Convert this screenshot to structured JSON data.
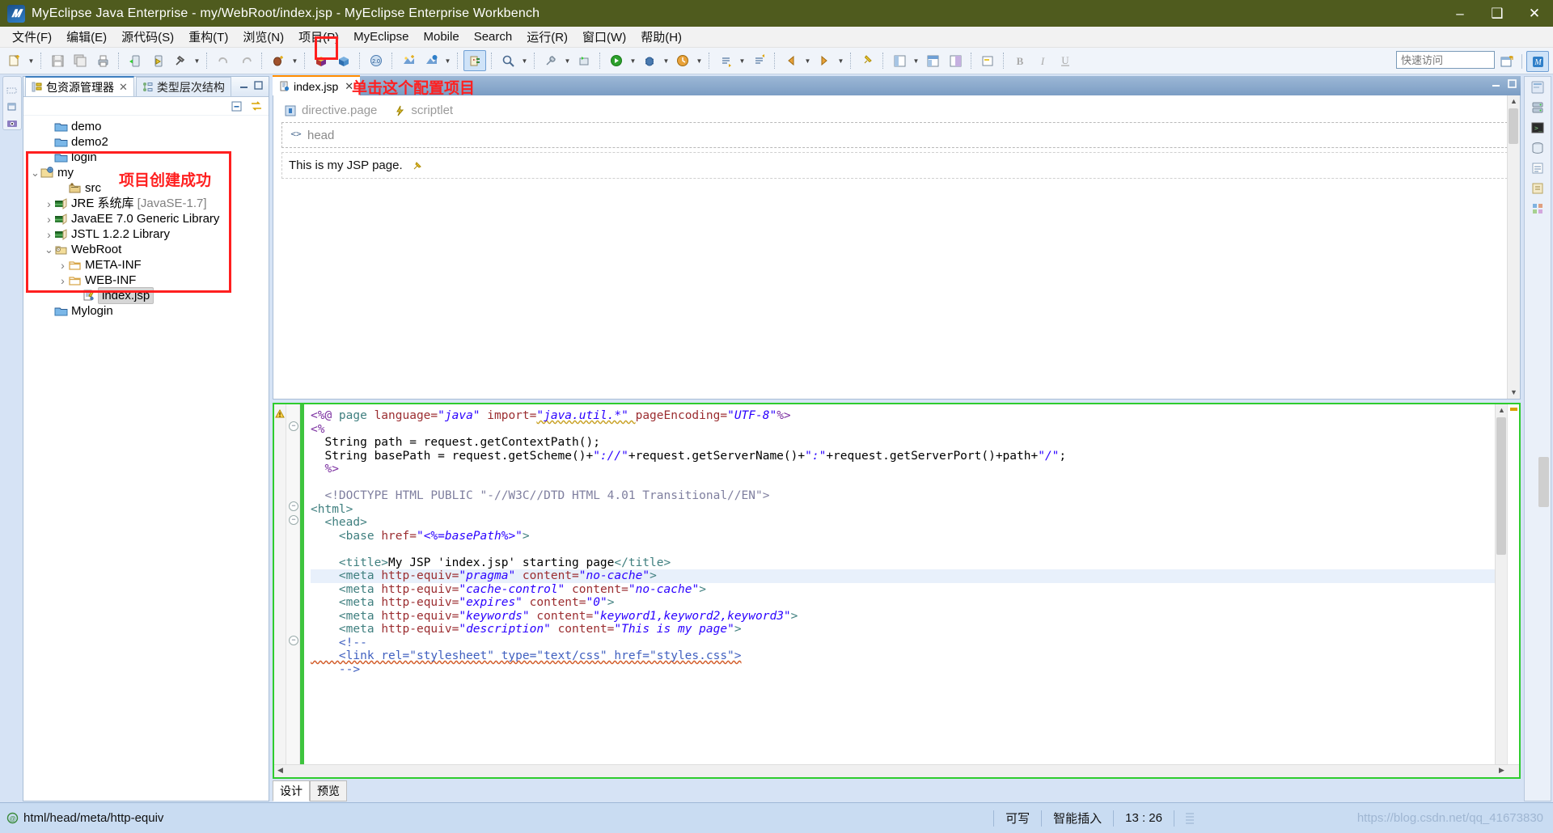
{
  "window": {
    "title": "MyEclipse Java Enterprise  -  my/WebRoot/index.jsp  -  MyEclipse Enterprise Workbench",
    "app_icon": "myeclipse-icon",
    "minimize": "–",
    "maximize": "❑",
    "close": "✕"
  },
  "menubar": {
    "items": [
      {
        "label": "文件(F)"
      },
      {
        "label": "编辑(E)"
      },
      {
        "label": "源代码(S)"
      },
      {
        "label": "重构(T)"
      },
      {
        "label": "浏览(N)"
      },
      {
        "label": "项目(P)"
      },
      {
        "label": "MyEclipse"
      },
      {
        "label": "Mobile"
      },
      {
        "label": "Search"
      },
      {
        "label": "运行(R)"
      },
      {
        "label": "窗口(W)"
      },
      {
        "label": "帮助(H)"
      }
    ]
  },
  "toolbar": {
    "quick_access_placeholder": "快速访问",
    "highlighted_button": "configure-project-button",
    "buttons": [
      "new-wizard-icon",
      "save-icon",
      "save-all-icon",
      "print-icon",
      "run-server-icon",
      "deploy-myeclipse-icon",
      "build-hammer-icon",
      "undo-arrow-icon",
      "redo-arrow-icon",
      "debug-bean-icon",
      "new-package-icon",
      "new-class-icon",
      "web-20-icon",
      "new-jsp-icon",
      "open-browser-icon",
      "configure-project-icon",
      "search-icon",
      "wrench-icon",
      "external-tools-icon",
      "run-icon",
      "debug-icon",
      "profile-icon",
      "next-annotation-icon",
      "previous-annotation-icon",
      "back-icon",
      "forward-icon",
      "pin-editor-icon",
      "perspective-java-icon",
      "perspective-web-icon",
      "perspective-db-icon",
      "toggle-mark-occurrences-icon",
      "bold-icon",
      "italic-icon",
      "underline-icon"
    ],
    "right_buttons": [
      "open-perspective-icon",
      "myeclipse-perspective-icon"
    ]
  },
  "annotations": {
    "toolbar_note": "单击这个配置项目",
    "tree_note": "项目创建成功"
  },
  "explorer": {
    "tabs": [
      {
        "label": "包资源管理器",
        "icon": "package-explorer-icon",
        "active": true,
        "closable": true
      },
      {
        "label": "类型层次结构",
        "icon": "type-hierarchy-icon",
        "active": false,
        "closable": false
      }
    ],
    "view_buttons": [
      "collapse-all-icon",
      "link-with-editor-icon",
      "view-menu-icon"
    ],
    "panel_buttons": [
      "minimize-icon",
      "maximize-icon"
    ],
    "tree": [
      {
        "label": "demo",
        "icon": "project-closed-icon",
        "indent": 1,
        "twisty": "",
        "selected": false
      },
      {
        "label": "demo2",
        "icon": "project-closed-icon",
        "indent": 1,
        "twisty": "",
        "selected": false
      },
      {
        "label": "login",
        "icon": "project-closed-icon",
        "indent": 1,
        "twisty": "",
        "selected": false
      },
      {
        "label": "my",
        "icon": "web-project-icon",
        "indent": 0,
        "twisty": "v",
        "selected": false
      },
      {
        "label": "src",
        "icon": "source-folder-icon",
        "indent": 2,
        "twisty": "",
        "selected": false
      },
      {
        "label": "JRE 系统库",
        "suffix": "[JavaSE-1.7]",
        "icon": "library-icon",
        "indent": 1,
        "twisty": ">",
        "selected": false
      },
      {
        "label": "JavaEE 7.0 Generic Library",
        "icon": "library-icon",
        "indent": 1,
        "twisty": ">",
        "selected": false
      },
      {
        "label": "JSTL 1.2.2 Library",
        "icon": "library-icon",
        "indent": 1,
        "twisty": ">",
        "selected": false
      },
      {
        "label": "WebRoot",
        "icon": "webroot-folder-icon",
        "indent": 1,
        "twisty": "v",
        "selected": false
      },
      {
        "label": "META-INF",
        "icon": "folder-icon",
        "indent": 2,
        "twisty": ">",
        "selected": false
      },
      {
        "label": "WEB-INF",
        "icon": "folder-icon",
        "indent": 2,
        "twisty": ">",
        "selected": false
      },
      {
        "label": "index.jsp",
        "icon": "jsp-file-icon",
        "indent": 3,
        "twisty": "",
        "selected": true
      },
      {
        "label": "Mylogin",
        "icon": "project-closed-icon",
        "indent": 1,
        "twisty": "",
        "selected": false
      }
    ]
  },
  "editor": {
    "tab": {
      "label": "index.jsp",
      "icon": "jsp-file-icon",
      "close": "✕"
    },
    "design": {
      "directive_label": "directive.page",
      "scriptlet_label": "scriptlet",
      "head_label": "head",
      "body_text": "This is my JSP page.",
      "directive_icon": "directive-icon",
      "scriptlet_icon": "scriptlet-icon",
      "head_icon": "angle-brackets-icon",
      "anchor_icon": "pin-icon"
    },
    "bottom_tabs": [
      {
        "label": "设计",
        "active": true
      },
      {
        "label": "预览",
        "active": false
      }
    ],
    "source": {
      "lines": [
        [
          [
            "k-dir",
            "<%@ "
          ],
          [
            "k-tag",
            "page "
          ],
          [
            "k-attr",
            "language="
          ],
          [
            "k-str",
            "\"java\" "
          ],
          [
            "k-attr",
            "import="
          ],
          [
            "k-str",
            "\"java.util.*\" "
          ],
          [
            "k-attr",
            "pageEncoding="
          ],
          [
            "k-str",
            "\"UTF-8\""
          ],
          [
            "k-dir",
            "%>"
          ]
        ],
        [
          [
            "k-dir",
            "<%"
          ]
        ],
        [
          [
            "k-java",
            "  String path = request.getContextPath();"
          ]
        ],
        [
          [
            "k-java",
            "  String basePath = request.getScheme()+"
          ],
          [
            "k-str",
            "\"://\""
          ],
          [
            "k-java",
            "+request.getServerName()+"
          ],
          [
            "k-str",
            "\":\""
          ],
          [
            "k-java",
            "+request.getServerPort()+path+"
          ],
          [
            "k-str",
            "\"/\""
          ],
          [
            "k-java",
            ";"
          ]
        ],
        [
          [
            "k-dir",
            "  %>"
          ]
        ],
        [
          [
            "k-plain",
            ""
          ]
        ],
        [
          [
            "k-doct",
            "  <!DOCTYPE HTML PUBLIC "
          ],
          [
            "k-str2",
            "\"-//W3C//DTD HTML 4.01 Transitional//EN\""
          ],
          [
            "k-doct",
            ">"
          ]
        ],
        [
          [
            "k-tag",
            "<html>"
          ]
        ],
        [
          [
            "k-tag",
            "  <head>"
          ]
        ],
        [
          [
            "k-tag",
            "    <base "
          ],
          [
            "k-attr",
            "href="
          ],
          [
            "k-str",
            "\"<%=basePath%>\""
          ],
          [
            "k-tag",
            ">"
          ]
        ],
        [
          [
            "k-plain",
            ""
          ]
        ],
        [
          [
            "k-tag",
            "    <title>"
          ],
          [
            "k-plain",
            "My JSP 'index.jsp' starting page"
          ],
          [
            "k-tag",
            "</title>"
          ]
        ],
        [
          [
            "k-tag",
            "    <meta "
          ],
          [
            "k-attr",
            "http-equiv="
          ],
          [
            "k-str",
            "\"pragma\" "
          ],
          [
            "k-attr",
            "content="
          ],
          [
            "k-str",
            "\"no-cache\""
          ],
          [
            "k-tag",
            ">"
          ]
        ],
        [
          [
            "k-tag",
            "    <meta "
          ],
          [
            "k-attr",
            "http-equiv="
          ],
          [
            "k-str",
            "\"cache-control\" "
          ],
          [
            "k-attr",
            "content="
          ],
          [
            "k-str",
            "\"no-cache\""
          ],
          [
            "k-tag",
            ">"
          ]
        ],
        [
          [
            "k-tag",
            "    <meta "
          ],
          [
            "k-attr",
            "http-equiv="
          ],
          [
            "k-str",
            "\"expires\" "
          ],
          [
            "k-attr",
            "content="
          ],
          [
            "k-str",
            "\"0\""
          ],
          [
            "k-tag",
            ">"
          ]
        ],
        [
          [
            "k-tag",
            "    <meta "
          ],
          [
            "k-attr",
            "http-equiv="
          ],
          [
            "k-str",
            "\"keywords\" "
          ],
          [
            "k-attr",
            "content="
          ],
          [
            "k-str",
            "\"keyword1,keyword2,keyword3\""
          ],
          [
            "k-tag",
            ">"
          ]
        ],
        [
          [
            "k-tag",
            "    <meta "
          ],
          [
            "k-attr",
            "http-equiv="
          ],
          [
            "k-str",
            "\"description\" "
          ],
          [
            "k-attr",
            "content="
          ],
          [
            "k-str",
            "\"This is my page\""
          ],
          [
            "k-tag",
            ">"
          ]
        ],
        [
          [
            "k-com",
            "    <!--"
          ]
        ],
        [
          [
            "k-com",
            "    <link rel=\"stylesheet\" type=\"text/css\" href=\"styles.css\">"
          ]
        ],
        [
          [
            "k-com",
            "    -->"
          ]
        ]
      ],
      "highlighted_line_index": 12,
      "warning_marker": "warning-triangle-icon"
    }
  },
  "statusbar": {
    "path": "html/head/meta/http-equiv",
    "path_icon": "element-marker-icon",
    "writable": "可写",
    "insert_mode": "智能插入",
    "cursor_position": "13 : 26",
    "watermark": "https://blog.csdn.net/qq_41673830"
  }
}
